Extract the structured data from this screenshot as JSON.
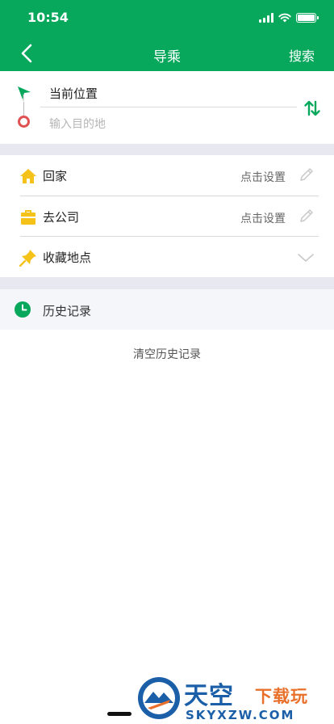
{
  "status_bar": {
    "time": "10:54"
  },
  "nav": {
    "title": "导乘",
    "search_label": "搜索"
  },
  "route": {
    "origin": "当前位置",
    "destination_placeholder": "输入目的地",
    "destination_value": ""
  },
  "places": [
    {
      "label": "回家",
      "action": "点击设置",
      "icon": "home-icon"
    },
    {
      "label": "去公司",
      "action": "点击设置",
      "icon": "briefcase-icon"
    },
    {
      "label": "收藏地点",
      "icon": "pin-icon"
    }
  ],
  "history": {
    "title": "历史记录",
    "clear_label": "清空历史记录"
  },
  "watermark": {
    "brand_a": "天空",
    "brand_b": "下载玩",
    "domain": "SKYXZW.COM"
  },
  "colors": {
    "header": "#07a85c",
    "accent": "#07a85c",
    "place_icon": "#f5c21a",
    "end_marker": "#e05252",
    "section_gap": "#e8e8f1"
  }
}
